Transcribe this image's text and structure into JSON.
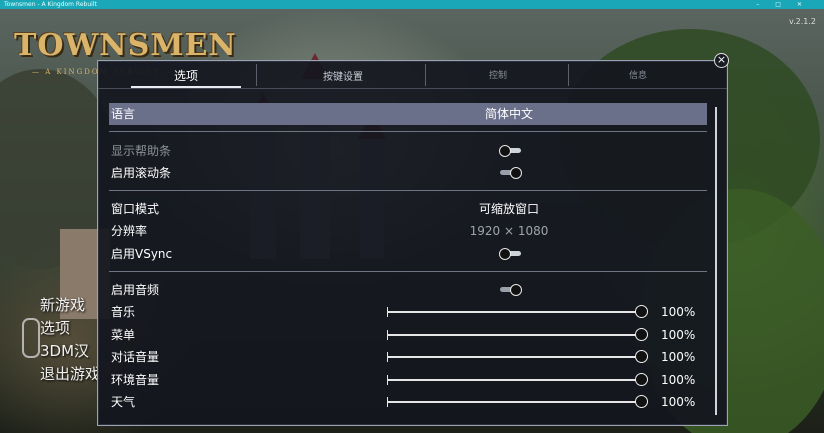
{
  "window": {
    "title": "Townsmen - A Kingdom Rebuilt",
    "controls": [
      "–",
      "□",
      "✕"
    ]
  },
  "game": {
    "logo": "TOWNSMEN",
    "logo_sub": "— A KINGDOM REBUILT —",
    "version": "v.2.1.2",
    "main_menu": [
      "新游戏",
      "选项",
      "3DM汉",
      "退出游戏"
    ]
  },
  "dialog": {
    "close_icon": "close-circle-icon",
    "tabs": [
      {
        "label": "选项",
        "active": true
      },
      {
        "label": "按键设置",
        "active": false
      },
      {
        "label": "控制",
        "active": false
      },
      {
        "label": "信息",
        "active": false
      }
    ],
    "settings": {
      "language": {
        "label": "语言",
        "value": "简体中文"
      },
      "show_help_bar": {
        "label": "显示帮助条",
        "enabled": false
      },
      "enable_scrollbar": {
        "label": "启用滚动条",
        "enabled": true
      },
      "window_mode": {
        "label": "窗口模式",
        "value": "可缩放窗口"
      },
      "resolution": {
        "label": "分辨率",
        "value": "1920 × 1080"
      },
      "vsync": {
        "label": "启用VSync",
        "enabled": false
      },
      "enable_audio": {
        "label": "启用音频",
        "enabled": true
      },
      "volumes": [
        {
          "label": "音乐",
          "level": 1.0,
          "text": "100%"
        },
        {
          "label": "菜单",
          "level": 1.0,
          "text": "100%"
        },
        {
          "label": "对话音量",
          "level": 1.0,
          "text": "100%"
        },
        {
          "label": "环境音量",
          "level": 1.0,
          "text": "100%"
        },
        {
          "label": "天气",
          "level": 1.0,
          "text": "100%"
        }
      ]
    }
  }
}
